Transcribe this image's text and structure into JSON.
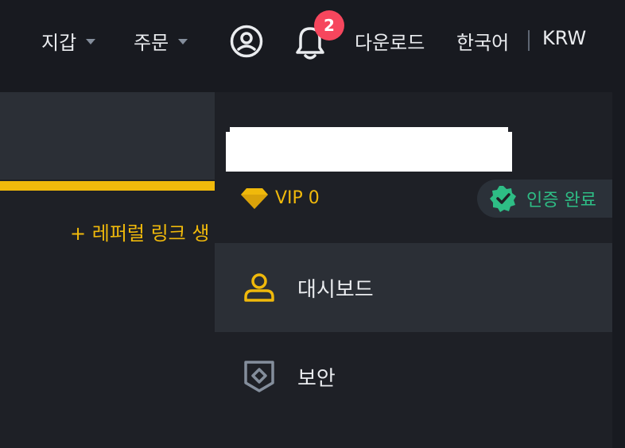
{
  "header": {
    "wallet_label": "지갑",
    "orders_label": "주문",
    "notifications_count": "2",
    "download_label": "다운로드",
    "language_label": "한국어",
    "currency_label": "KRW"
  },
  "left_panel": {
    "referral_label": "+ 레퍼럴 링크 생"
  },
  "dropdown": {
    "vip_label": "VIP 0",
    "verified_label": "인증 완료",
    "items": [
      {
        "label": "대시보드",
        "icon": "user-icon",
        "active": true
      },
      {
        "label": "보안",
        "icon": "shield-icon",
        "active": false
      }
    ]
  },
  "colors": {
    "accent": "#f0b90b",
    "success": "#2ebd85",
    "badge": "#f6465d",
    "background": "#181a20"
  }
}
